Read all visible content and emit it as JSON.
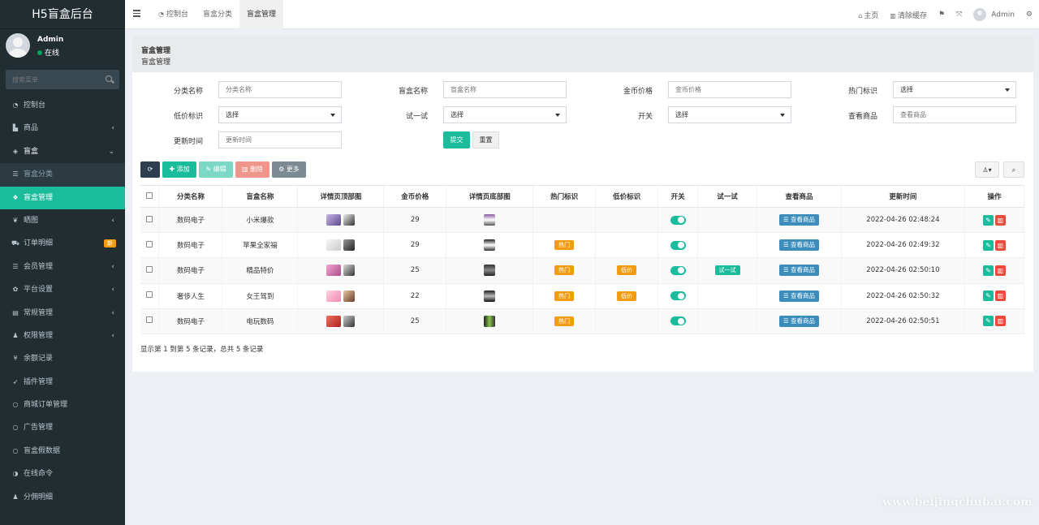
{
  "sidebar": {
    "brand": "H5盲盒后台",
    "user_name": "Admin",
    "user_status": "在线",
    "search_placeholder": "搜索菜单",
    "items": [
      {
        "label": "控制台",
        "icon": "dashboard-icon"
      },
      {
        "label": "商品",
        "icon": "shopping-bag-icon"
      },
      {
        "label": "盲盒",
        "icon": "cube-icon"
      },
      {
        "label": "盲盒分类",
        "icon": "list-icon"
      },
      {
        "label": "盲盒管理",
        "icon": "cubes-icon"
      },
      {
        "label": "晒图",
        "icon": "image-icon"
      },
      {
        "label": "订单明细",
        "icon": "cart-icon",
        "badge": "新"
      },
      {
        "label": "会员管理",
        "icon": "list-icon"
      },
      {
        "label": "平台设置",
        "icon": "gear-icon"
      },
      {
        "label": "常规管理",
        "icon": "database-icon"
      },
      {
        "label": "权限管理",
        "icon": "group-icon"
      },
      {
        "label": "余额记录",
        "icon": "yen-icon"
      },
      {
        "label": "插件管理",
        "icon": "rocket-icon"
      },
      {
        "label": "商城订单管理",
        "icon": "circle-icon"
      },
      {
        "label": "广告管理",
        "icon": "circle-icon"
      },
      {
        "label": "盲盒假数据",
        "icon": "circle-icon"
      },
      {
        "label": "在线命令",
        "icon": "half-circle-icon"
      },
      {
        "label": "分佣明细",
        "icon": "group-icon"
      }
    ]
  },
  "topbar": {
    "tabs": [
      "控制台",
      "盲盒分类",
      "盲盒管理"
    ],
    "home": "主页",
    "clear_cache": "清除缓存",
    "admin": "Admin"
  },
  "panel": {
    "title": "盲盒管理",
    "subtitle": "盲盒管理"
  },
  "filters": {
    "category_label": "分类名称",
    "category_placeholder": "分类名称",
    "name_label": "盲盒名称",
    "name_placeholder": "盲盒名称",
    "price_label": "金币价格",
    "price_placeholder": "金币价格",
    "hot_label": "热门标识",
    "hot_value": "选择",
    "low_label": "低价标识",
    "low_value": "选择",
    "try_label": "试一试",
    "try_value": "选择",
    "switch_label": "开关",
    "switch_value": "选择",
    "goods_label": "查看商品",
    "goods_placeholder": "查看商品",
    "time_label": "更新时间",
    "time_placeholder": "更新时间",
    "submit": "提交",
    "reset": "重置"
  },
  "toolbar": {
    "add": "添加",
    "edit": "编辑",
    "delete": "删除",
    "more": "更多"
  },
  "table": {
    "headers": [
      "分类名称",
      "盲盒名称",
      "详情页顶部图",
      "金币价格",
      "详情页底部图",
      "热门标识",
      "低价标识",
      "开关",
      "试一试",
      "查看商品",
      "更新时间",
      "操作"
    ],
    "view_label": "查看商品",
    "rows": [
      {
        "category": "数码电子",
        "name": "小米爆款",
        "price": "29",
        "hot": "",
        "low": "",
        "try": "",
        "time": "2022-04-26 02:48:24"
      },
      {
        "category": "数码电子",
        "name": "苹果全家福",
        "price": "29",
        "hot": "热门",
        "low": "",
        "try": "",
        "time": "2022-04-26 02:49:32"
      },
      {
        "category": "数码电子",
        "name": "精品特价",
        "price": "25",
        "hot": "热门",
        "low": "低价",
        "try": "试一试",
        "time": "2022-04-26 02:50:10"
      },
      {
        "category": "奢侈人生",
        "name": "女王驾到",
        "price": "22",
        "hot": "热门",
        "low": "低价",
        "try": "",
        "time": "2022-04-26 02:50:32"
      },
      {
        "category": "数码电子",
        "name": "电玩数码",
        "price": "25",
        "hot": "热门",
        "low": "",
        "try": "",
        "time": "2022-04-26 02:50:51"
      }
    ],
    "footer": "显示第 1 到第 5 条记录，总共 5 条记录"
  },
  "colors": {
    "sidebar_bg": "#222d32",
    "accent": "#1abc9c",
    "hot": "#f39c12",
    "view_button": "#3c8dbc",
    "danger": "#e74c3c"
  },
  "watermark": "www.beijingchuhai.com"
}
